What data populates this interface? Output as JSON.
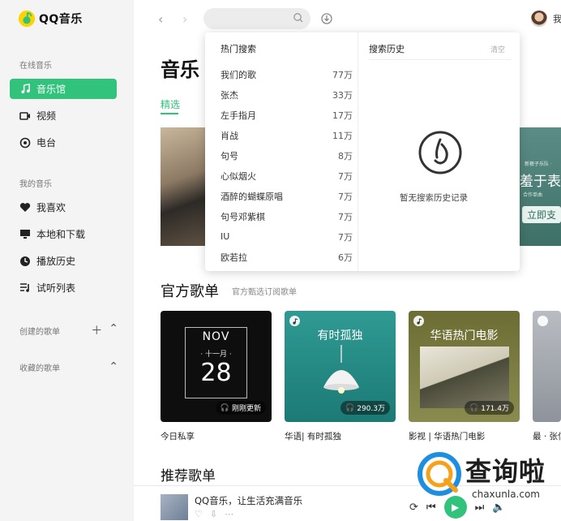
{
  "app": {
    "logo_text": "QQ音乐"
  },
  "colors": {
    "accent": "#31c27c"
  },
  "sidebar": {
    "sections": [
      {
        "label": "在线音乐"
      },
      {
        "label": "我的音乐"
      }
    ],
    "online_items": [
      {
        "label": "音乐馆",
        "icon": "music-note-icon",
        "active": true
      },
      {
        "label": "视频",
        "icon": "video-icon"
      },
      {
        "label": "电台",
        "icon": "radio-icon"
      }
    ],
    "my_items": [
      {
        "label": "我喜欢",
        "icon": "heart-icon"
      },
      {
        "label": "本地和下载",
        "icon": "monitor-icon"
      },
      {
        "label": "播放历史",
        "icon": "clock-icon"
      },
      {
        "label": "试听列表",
        "icon": "playlist-icon"
      }
    ],
    "created_playlists": "创建的歌单",
    "collected_playlists": "收藏的歌单"
  },
  "header": {
    "search_placeholder": "",
    "user_name": "我"
  },
  "main": {
    "page_title": "音乐",
    "tabs": [
      {
        "label": "精选",
        "active": true
      }
    ],
    "banner_right": {
      "line1": "新裤子乐队 ·",
      "line2": "羞于表",
      "line3": "合作单曲",
      "button": "立即支"
    },
    "official_title": "官方歌单",
    "official_subtitle": "官方甄选订阅歌单",
    "cards": [
      {
        "caption": "今日私享",
        "play_count": "刚刚更新",
        "cal_month": "NOV",
        "cal_lunar": "· 十一月 ·",
        "cal_day": "28"
      },
      {
        "caption": "华语| 有时孤独",
        "play_count": "290.3万",
        "cover_title": "有时孤独"
      },
      {
        "caption": "影视 | 华语热门电影",
        "play_count": "171.4万",
        "cover_title": "华语热门电影"
      },
      {
        "caption": "最 · 张信"
      }
    ],
    "recommended_title": "推荐歌单"
  },
  "player": {
    "title": "QQ音乐，让生活充满音乐"
  },
  "search_dropdown": {
    "hot_title": "热门搜索",
    "history_title": "搜索历史",
    "clear_label": "清空",
    "empty_text": "暂无搜索历史记录",
    "hot_items": [
      {
        "term": "我们的歌",
        "count": "77万"
      },
      {
        "term": "张杰",
        "count": "33万"
      },
      {
        "term": "左手指月",
        "count": "17万"
      },
      {
        "term": "肖战",
        "count": "11万"
      },
      {
        "term": "句号",
        "count": "8万"
      },
      {
        "term": "心似烟火",
        "count": "7万"
      },
      {
        "term": "酒醉的蝴蝶原唱",
        "count": "7万"
      },
      {
        "term": "句号邓紫棋",
        "count": "7万"
      },
      {
        "term": "IU",
        "count": "7万"
      },
      {
        "term": "欧若拉",
        "count": "6万"
      }
    ]
  },
  "watermark": {
    "text": "查询啦",
    "url": "chaxunla.com"
  }
}
